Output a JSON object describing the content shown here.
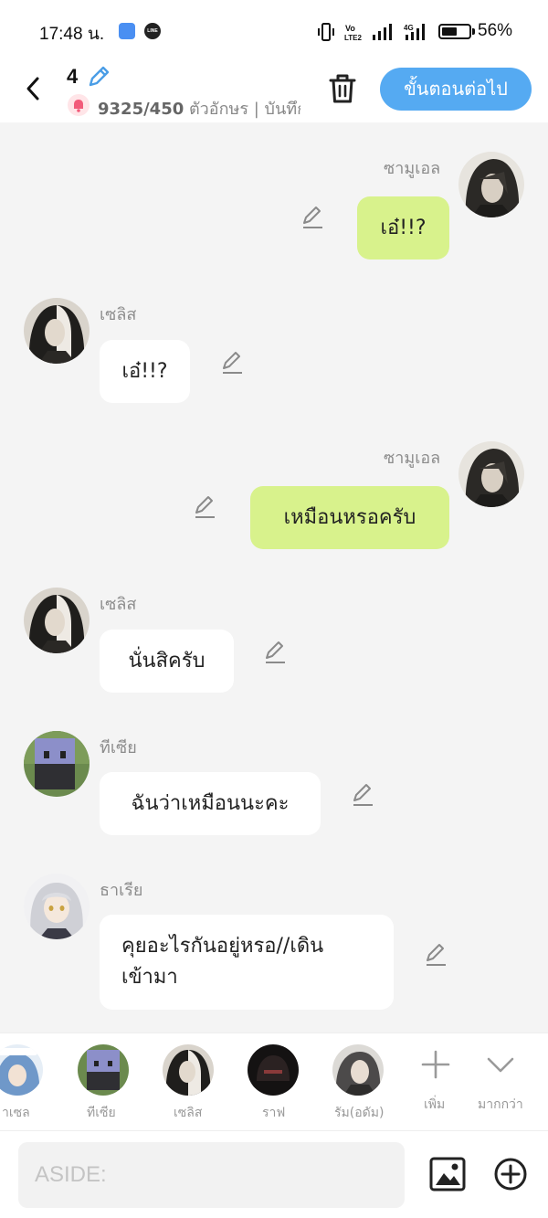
{
  "status_bar": {
    "time": "17:48 น.",
    "battery_percent": "56%",
    "battery_level": 0.56,
    "app_icons": [
      "messenger-icon",
      "line-icon"
    ],
    "line_label": "LINE",
    "system_icons": [
      "vibrate-icon",
      "volte-icon",
      "signal-icon",
      "4g-signal-icon",
      "battery-icon"
    ]
  },
  "header": {
    "episode_number": "4",
    "char_count": "9325/450",
    "meta_rest": " ตัวอักษร | บันทึก",
    "next_button": "ขั้นตอนต่อไป",
    "icons": [
      "back-icon",
      "edit-pencil-icon",
      "bell-icon",
      "trash-icon"
    ]
  },
  "messages": [
    {
      "sender": "ซามูเอล",
      "text": "เอ๋!!?",
      "side": "right"
    },
    {
      "sender": "เซลิส",
      "text": "เอ๋!!?",
      "side": "left"
    },
    {
      "sender": "ซามูเอล",
      "text": "เหมือนหรอครับ",
      "side": "right"
    },
    {
      "sender": "เซลิส",
      "text": "นั่นสิครับ",
      "side": "left"
    },
    {
      "sender": "ทีเซีย",
      "text": "ฉันว่าเหมือนนะคะ",
      "side": "left"
    },
    {
      "sender": "ธาเรีย",
      "text": "คุยอะไรกันอยู่หรอ//เดิน",
      "text_line2": "เข้ามา",
      "side": "left"
    }
  ],
  "characters": [
    "าเซล",
    "ทีเซีย",
    "เซลิส",
    "ราฟ",
    "รัม(อดัม)"
  ],
  "char_tools": {
    "add": "เพิ่ม",
    "more": "มากกว่า"
  },
  "input": {
    "placeholder": "ASIDE:",
    "icons": [
      "image-icon",
      "add-circle-icon"
    ]
  },
  "colors": {
    "accent": "#55aaf2",
    "my_bubble": "#d8f28c",
    "their_bubble": "#ffffff",
    "chat_background": "#f4f4f4"
  }
}
